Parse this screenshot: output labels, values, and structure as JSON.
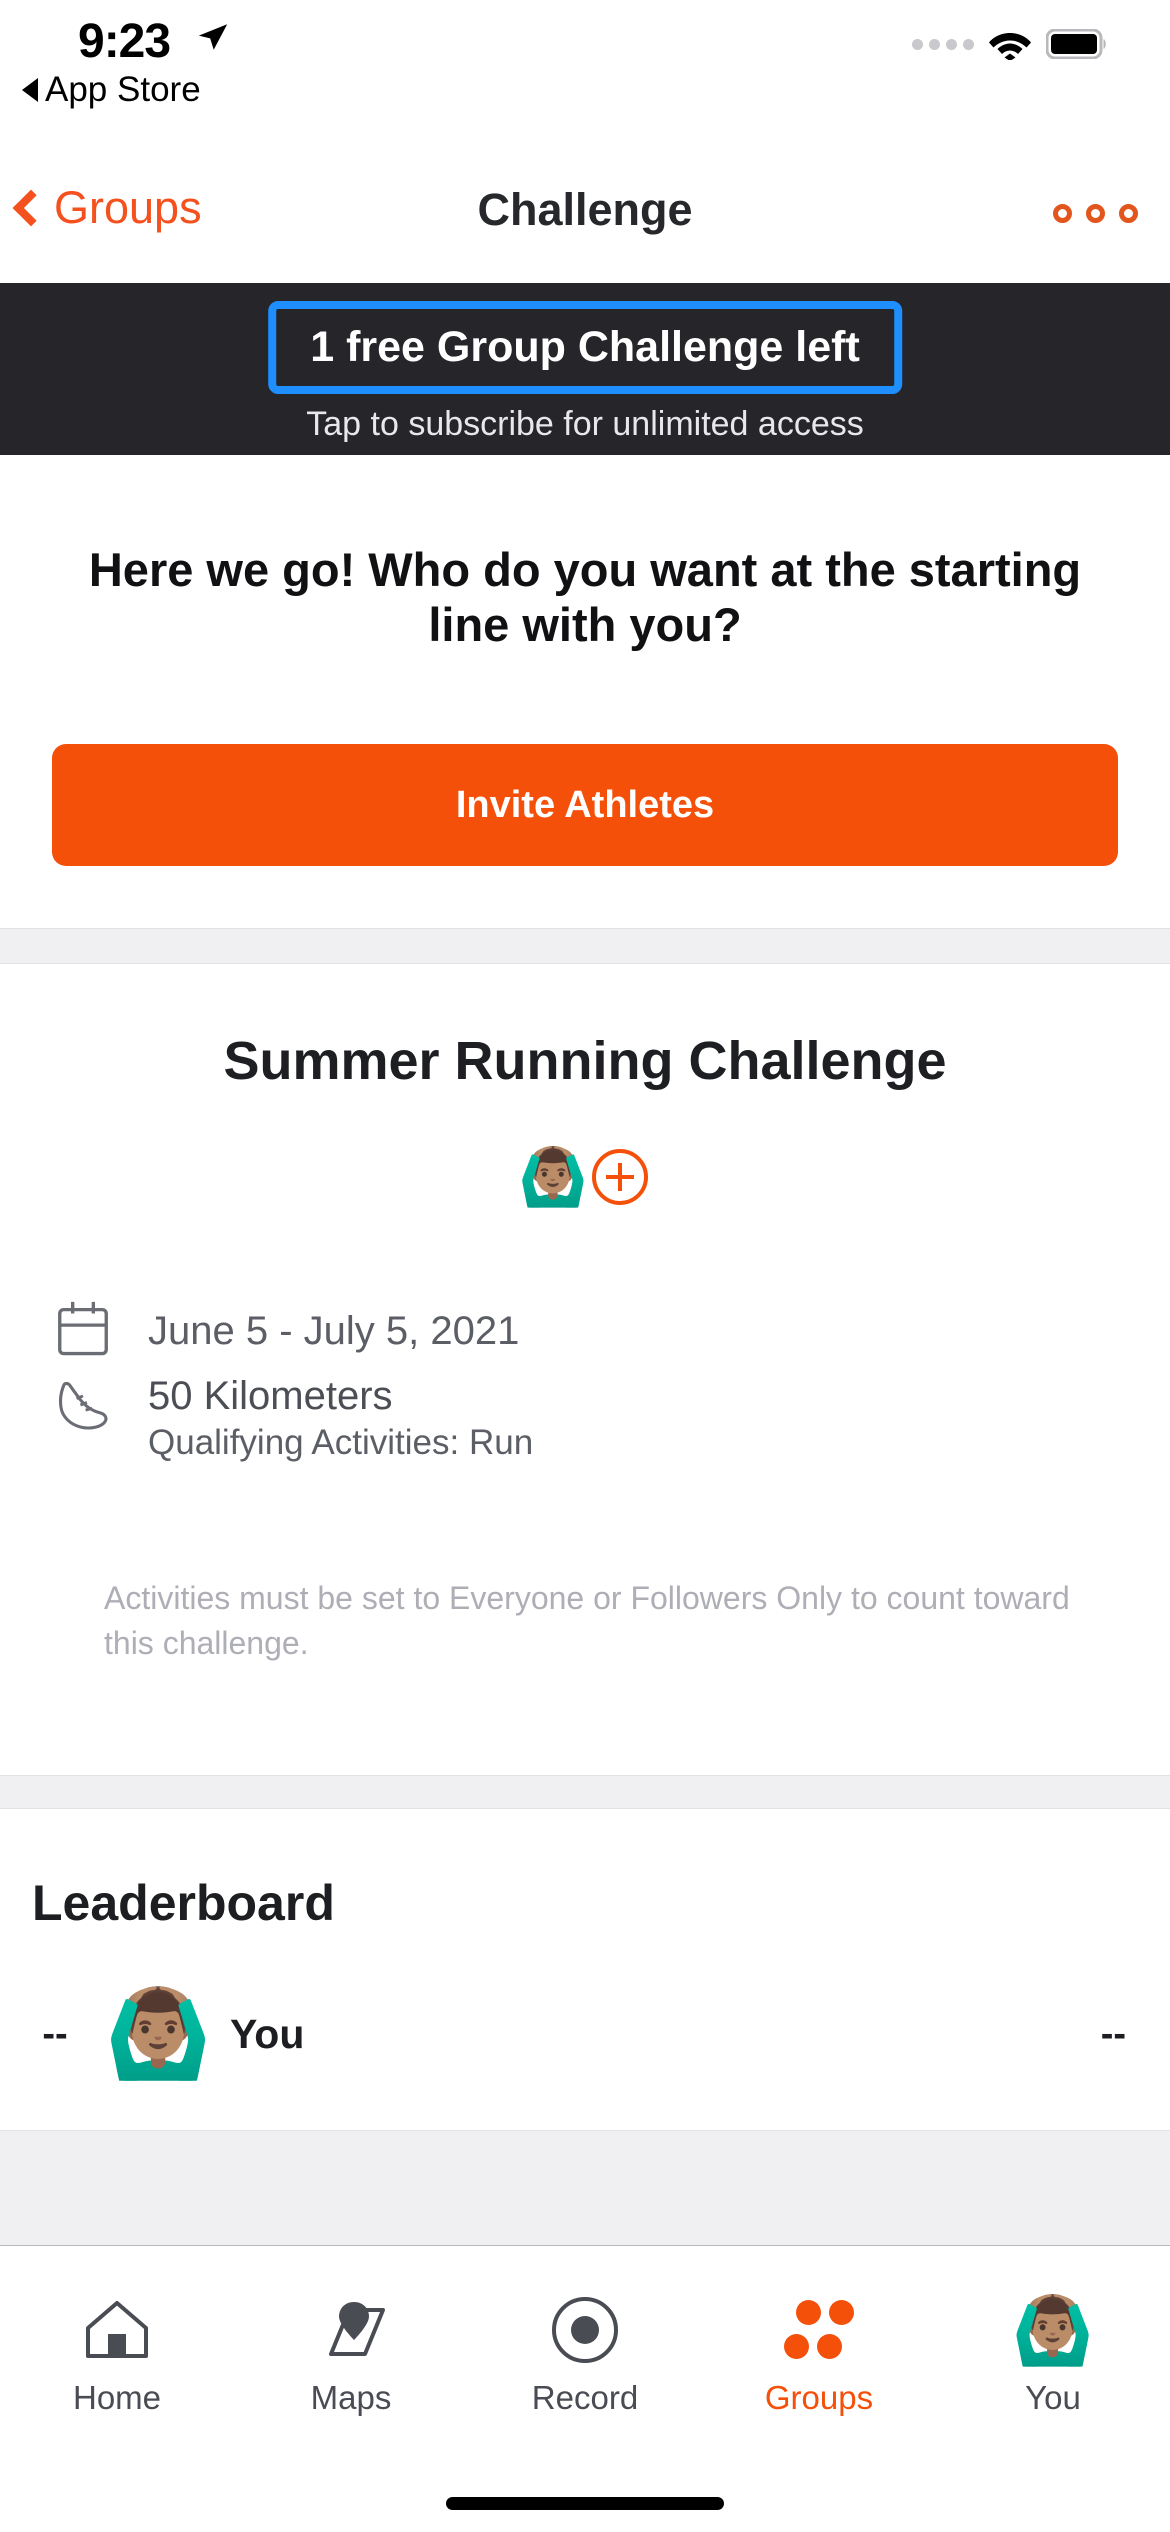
{
  "status_bar": {
    "time": "9:23",
    "location_icon": "location-arrow-icon",
    "back_to_app": "App Store",
    "cellular_icon": "cellular-dots-icon",
    "wifi_icon": "wifi-icon",
    "battery_icon": "battery-full-icon"
  },
  "nav_bar": {
    "back_label": "Groups",
    "title": "Challenge",
    "more_icon": "more-options-icon",
    "accent_color": "#f4511e"
  },
  "promo_banner": {
    "title": "1 free Group Challenge left",
    "subtitle": "Tap to subscribe for unlimited access",
    "background_color": "#26262a",
    "outline_color": "#1f8eff"
  },
  "invite_section": {
    "headline": "Here we go! Who do you want at the starting line with you?",
    "button_label": "Invite Athletes",
    "button_color": "#f4500a"
  },
  "challenge": {
    "title": "Summer Running Challenge",
    "participants": [
      {
        "avatar": "🙆🏽‍♂️",
        "name": "participant-avatar"
      }
    ],
    "add_participant_icon": "add-participant-icon",
    "date_icon": "calendar-icon",
    "date_range": "June 5 - July 5, 2021",
    "distance_icon": "running-shoe-icon",
    "distance": "50 Kilometers",
    "qualifying_activities": "Qualifying Activities: Run",
    "disclaimer": "Activities must be set to Everyone or Followers Only to count toward this challenge."
  },
  "leaderboard": {
    "title": "Leaderboard",
    "rows": [
      {
        "rank": "--",
        "avatar": "🙆🏽‍♂️",
        "name": "You",
        "value": "--"
      }
    ]
  },
  "tab_bar": {
    "items": [
      {
        "label": "Home",
        "icon": "home-icon",
        "active": false
      },
      {
        "label": "Maps",
        "icon": "maps-icon",
        "active": false
      },
      {
        "label": "Record",
        "icon": "record-icon",
        "active": false
      },
      {
        "label": "Groups",
        "icon": "groups-icon",
        "active": true
      },
      {
        "label": "You",
        "icon": "profile-avatar-icon",
        "active": false
      }
    ],
    "active_color": "#f4500a",
    "inactive_color": "#4a4c53"
  }
}
